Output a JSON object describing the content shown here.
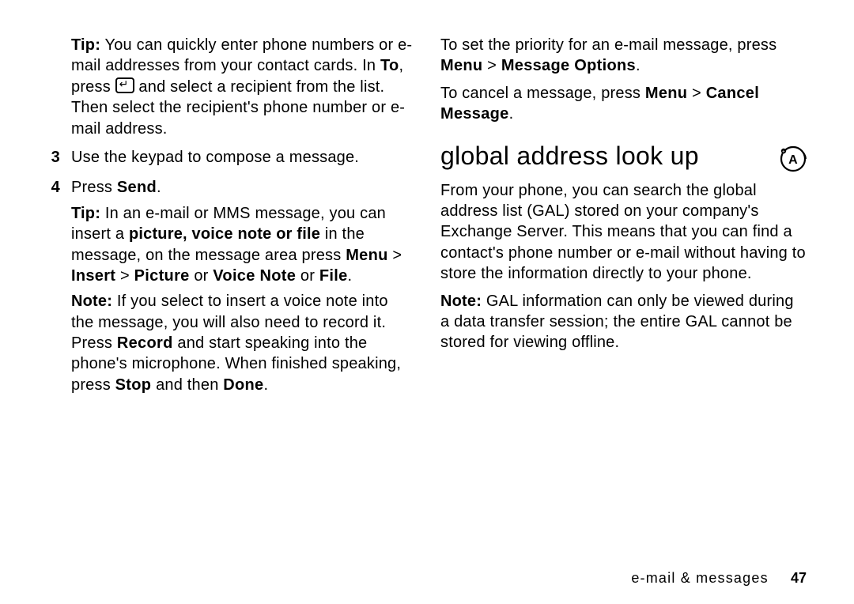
{
  "left": {
    "tip1_label": "Tip:",
    "tip1_a": " You can quickly enter phone numbers or e-mail addresses from your contact cards. In ",
    "tip1_to": "To",
    "tip1_b": ", press ",
    "tip1_c": " and select a recipient from the list. Then select the recipient's phone number or e-mail address.",
    "step3_num": "3",
    "step3_text": "Use the keypad to compose a message.",
    "step4_num": "4",
    "step4_a": "Press ",
    "step4_send": "Send",
    "step4_b": ".",
    "tip2_label": "Tip:",
    "tip2_a": " In an e-mail or MMS message, you can insert a ",
    "tip2_bold": "picture, voice note or file",
    "tip2_b": " in the message, on the message area press ",
    "tip2_menu_path_a": "Menu",
    "tip2_menu_gt1": " > ",
    "tip2_menu_path_b": "Insert",
    "tip2_menu_gt2": " > ",
    "tip2_menu_path_c": "Picture",
    "tip2_or1": " or ",
    "tip2_menu_path_d": "Voice Note",
    "tip2_or2": " or ",
    "tip2_menu_path_e": "File",
    "tip2_c": ".",
    "note_label": "Note:",
    "note_a": " If you select to insert a voice note into the message, you will also need to record it. Press ",
    "note_record": "Record",
    "note_b": " and start speaking into the phone's microphone. When finished speaking, press ",
    "note_stop": "Stop",
    "note_c": " and then ",
    "note_done": "Done",
    "note_d": "."
  },
  "right": {
    "p1_a": "To set the priority for an e-mail message, press ",
    "p1_menu": "Menu",
    "p1_gt": " > ",
    "p1_opt": "Message Options",
    "p1_b": ".",
    "p2_a": "To cancel a message, press ",
    "p2_menu": "Menu",
    "p2_gt": " > ",
    "p2_cancel": "Cancel Message",
    "p2_b": ".",
    "heading": "global address look up",
    "gal_a": "From your phone, you can search the global address list (GAL) stored on your company's Exchange Server. This means that you can find a contact's phone number or e-mail without having to store the information directly to your phone.",
    "gal_note_label": "Note:",
    "gal_note_a": " GAL information can only be viewed during a data transfer session; the entire GAL cannot be stored for viewing offline."
  },
  "footer": {
    "section": "e-mail & messages",
    "page": "47"
  }
}
